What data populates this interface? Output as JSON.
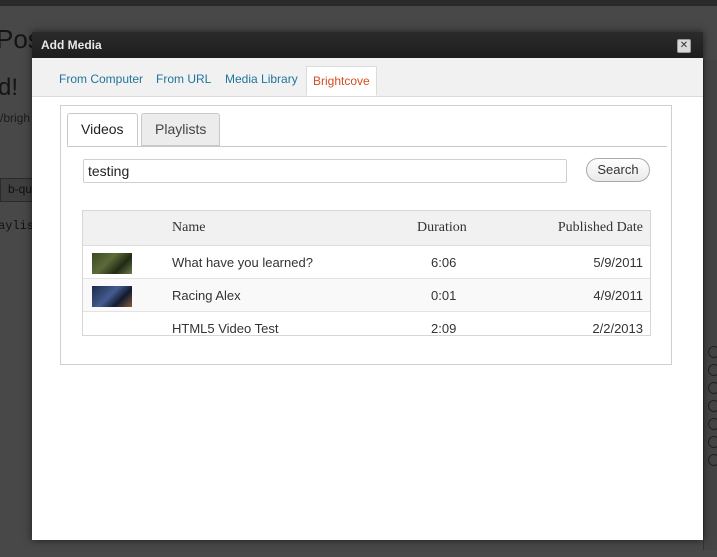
{
  "background": {
    "title_fragment": "Pos",
    "heading_fragment": "d!",
    "slug_fragment": "/brigh",
    "input_fragment": "b-qu",
    "mono_fragment": "aylis"
  },
  "modal": {
    "title": "Add Media",
    "close_symbol": "✕",
    "tabs": [
      "From Computer",
      "From URL",
      "Media Library",
      "Brightcove"
    ],
    "active_tab": "Brightcove",
    "inner_tabs": [
      "Videos",
      "Playlists"
    ],
    "search": {
      "value": "testing",
      "button": "Search"
    },
    "table": {
      "headers": [
        "Name",
        "Duration",
        "Published Date"
      ],
      "rows": [
        {
          "name": "What have you learned?",
          "duration": "6:06",
          "published": "5/9/2011",
          "thumb": "thumb-learned"
        },
        {
          "name": "Racing Alex",
          "duration": "0:01",
          "published": "4/9/2011",
          "thumb": "thumb-racing"
        },
        {
          "name": "HTML5 Video Test",
          "duration": "2:09",
          "published": "2/2/2013",
          "thumb": ""
        }
      ]
    }
  },
  "colors": {
    "link": "#21759b",
    "active_tab": "#d54e21"
  }
}
